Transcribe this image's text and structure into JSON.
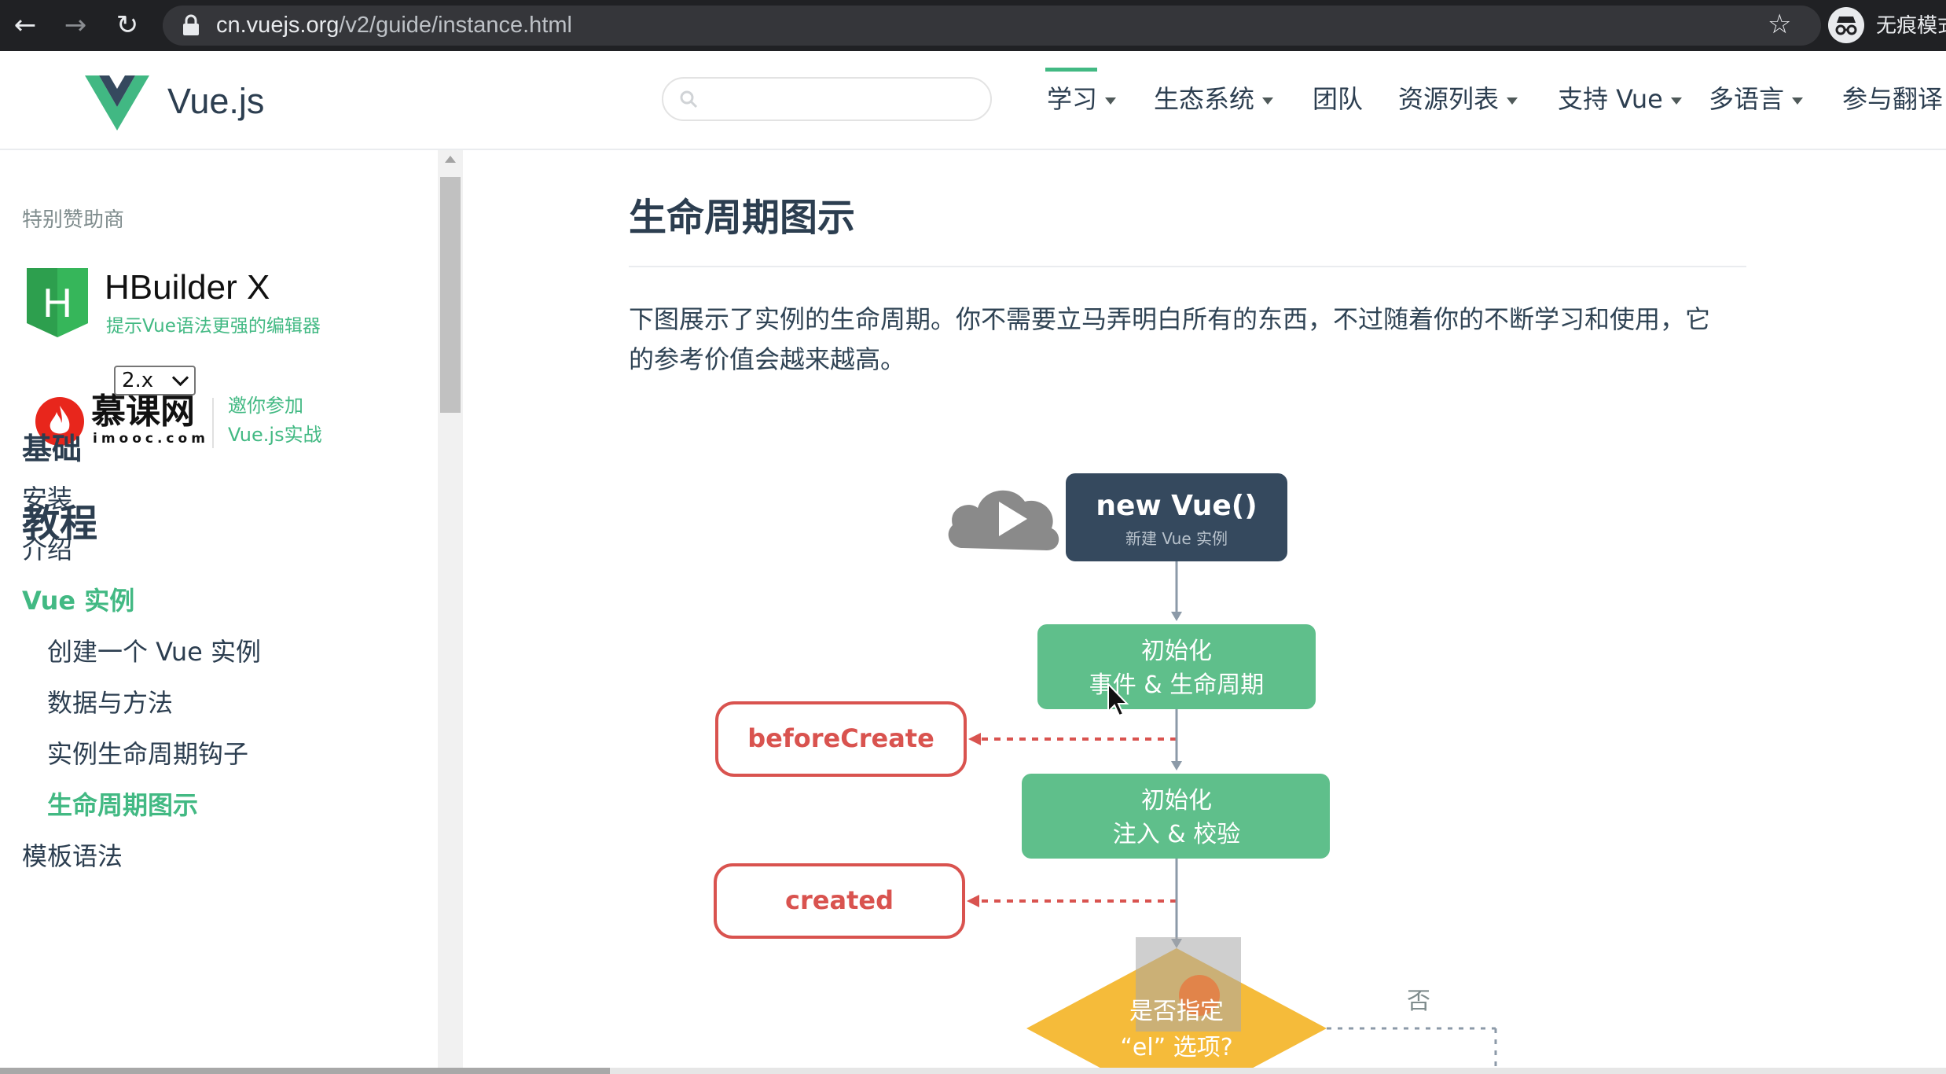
{
  "browser": {
    "url_domain": "cn.vuejs.org",
    "url_path": "/v2/guide/instance.html",
    "incognito_label": "无痕模式"
  },
  "header": {
    "brand": "Vue.js",
    "search_placeholder": "",
    "nav": [
      {
        "label": "学习",
        "dropdown": true,
        "active": true
      },
      {
        "label": "生态系统",
        "dropdown": true
      },
      {
        "label": "团队",
        "dropdown": false
      },
      {
        "label": "资源列表",
        "dropdown": true
      },
      {
        "label": "支持 Vue",
        "dropdown": true
      },
      {
        "label": "多语言",
        "dropdown": true
      },
      {
        "label": "参与翻译",
        "dropdown": false
      }
    ]
  },
  "sidebar": {
    "sponsor_title": "特别赞助商",
    "hbuilder": {
      "name": "HBuilder X",
      "desc": "提示Vue语法更强的编辑器"
    },
    "imooc": {
      "name": "慕课网",
      "sub": "imooc.com",
      "invite_line1": "邀你参加",
      "invite_line2": "Vue.js实战"
    },
    "tutorial_title": "教程",
    "version": "2.x",
    "section": "基础",
    "items": [
      {
        "label": "安装",
        "level": 0,
        "active": false
      },
      {
        "label": "介绍",
        "level": 0,
        "active": false
      },
      {
        "label": "Vue 实例",
        "level": 0,
        "active": true
      },
      {
        "label": "创建一个 Vue 实例",
        "level": 1,
        "active": false
      },
      {
        "label": "数据与方法",
        "level": 1,
        "active": false
      },
      {
        "label": "实例生命周期钩子",
        "level": 1,
        "active": false
      },
      {
        "label": "生命周期图示",
        "level": 1,
        "active": true
      },
      {
        "label": "模板语法",
        "level": 0,
        "active": false
      }
    ]
  },
  "main": {
    "title": "生命周期图示",
    "paragraph_line1": "下图展示了实例的生命周期。你不需要立马弄明白所有的东西，不过随着你的不断学习和使用，它",
    "paragraph_line2": "的参考价值会越来越高。",
    "diagram": {
      "new_vue": "new Vue()",
      "new_vue_sub": "新建 Vue 实例",
      "init1_line1": "初始化",
      "init1_line2": "事件 & 生命周期",
      "before_create": "beforeCreate",
      "init2_line1": "初始化",
      "init2_line2": "注入 & 校验",
      "created": "created",
      "question_line1": "是否指定",
      "question_line2": "“el” 选项?",
      "no_label": "否"
    }
  },
  "colors": {
    "accent": "#42b983",
    "text": "#2c3e50",
    "dark_node": "#35495e",
    "green_node": "#5fbf8b",
    "hook_red": "#d9534f",
    "diamond": "#f5bb3a"
  }
}
